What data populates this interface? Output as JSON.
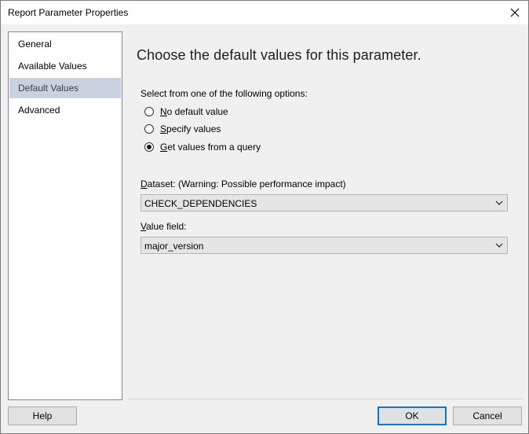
{
  "window": {
    "title": "Report Parameter Properties"
  },
  "nav": {
    "items": [
      {
        "label": "General"
      },
      {
        "label": "Available Values"
      },
      {
        "label": "Default Values",
        "selected": true
      },
      {
        "label": "Advanced"
      }
    ]
  },
  "main": {
    "heading": "Choose the default values for this parameter.",
    "options_prompt": "Select from one of the following options:",
    "options": [
      {
        "mnemonic": "N",
        "rest": "o default value",
        "checked": false
      },
      {
        "mnemonic": "S",
        "rest": "pecify values",
        "checked": false
      },
      {
        "mnemonic": "G",
        "rest": "et values from a query",
        "checked": true
      }
    ],
    "dataset": {
      "label_mnemonic": "D",
      "label_rest": "ataset: (Warning: Possible performance impact)",
      "value": "CHECK_DEPENDENCIES"
    },
    "value_field": {
      "label_mnemonic": "V",
      "label_rest": "alue field:",
      "value": "major_version"
    }
  },
  "footer": {
    "help_label": "Help",
    "ok_label": "OK",
    "cancel_label": "Cancel"
  },
  "icons": {
    "close": "close-icon",
    "dropdown": "chevron-down-icon"
  }
}
